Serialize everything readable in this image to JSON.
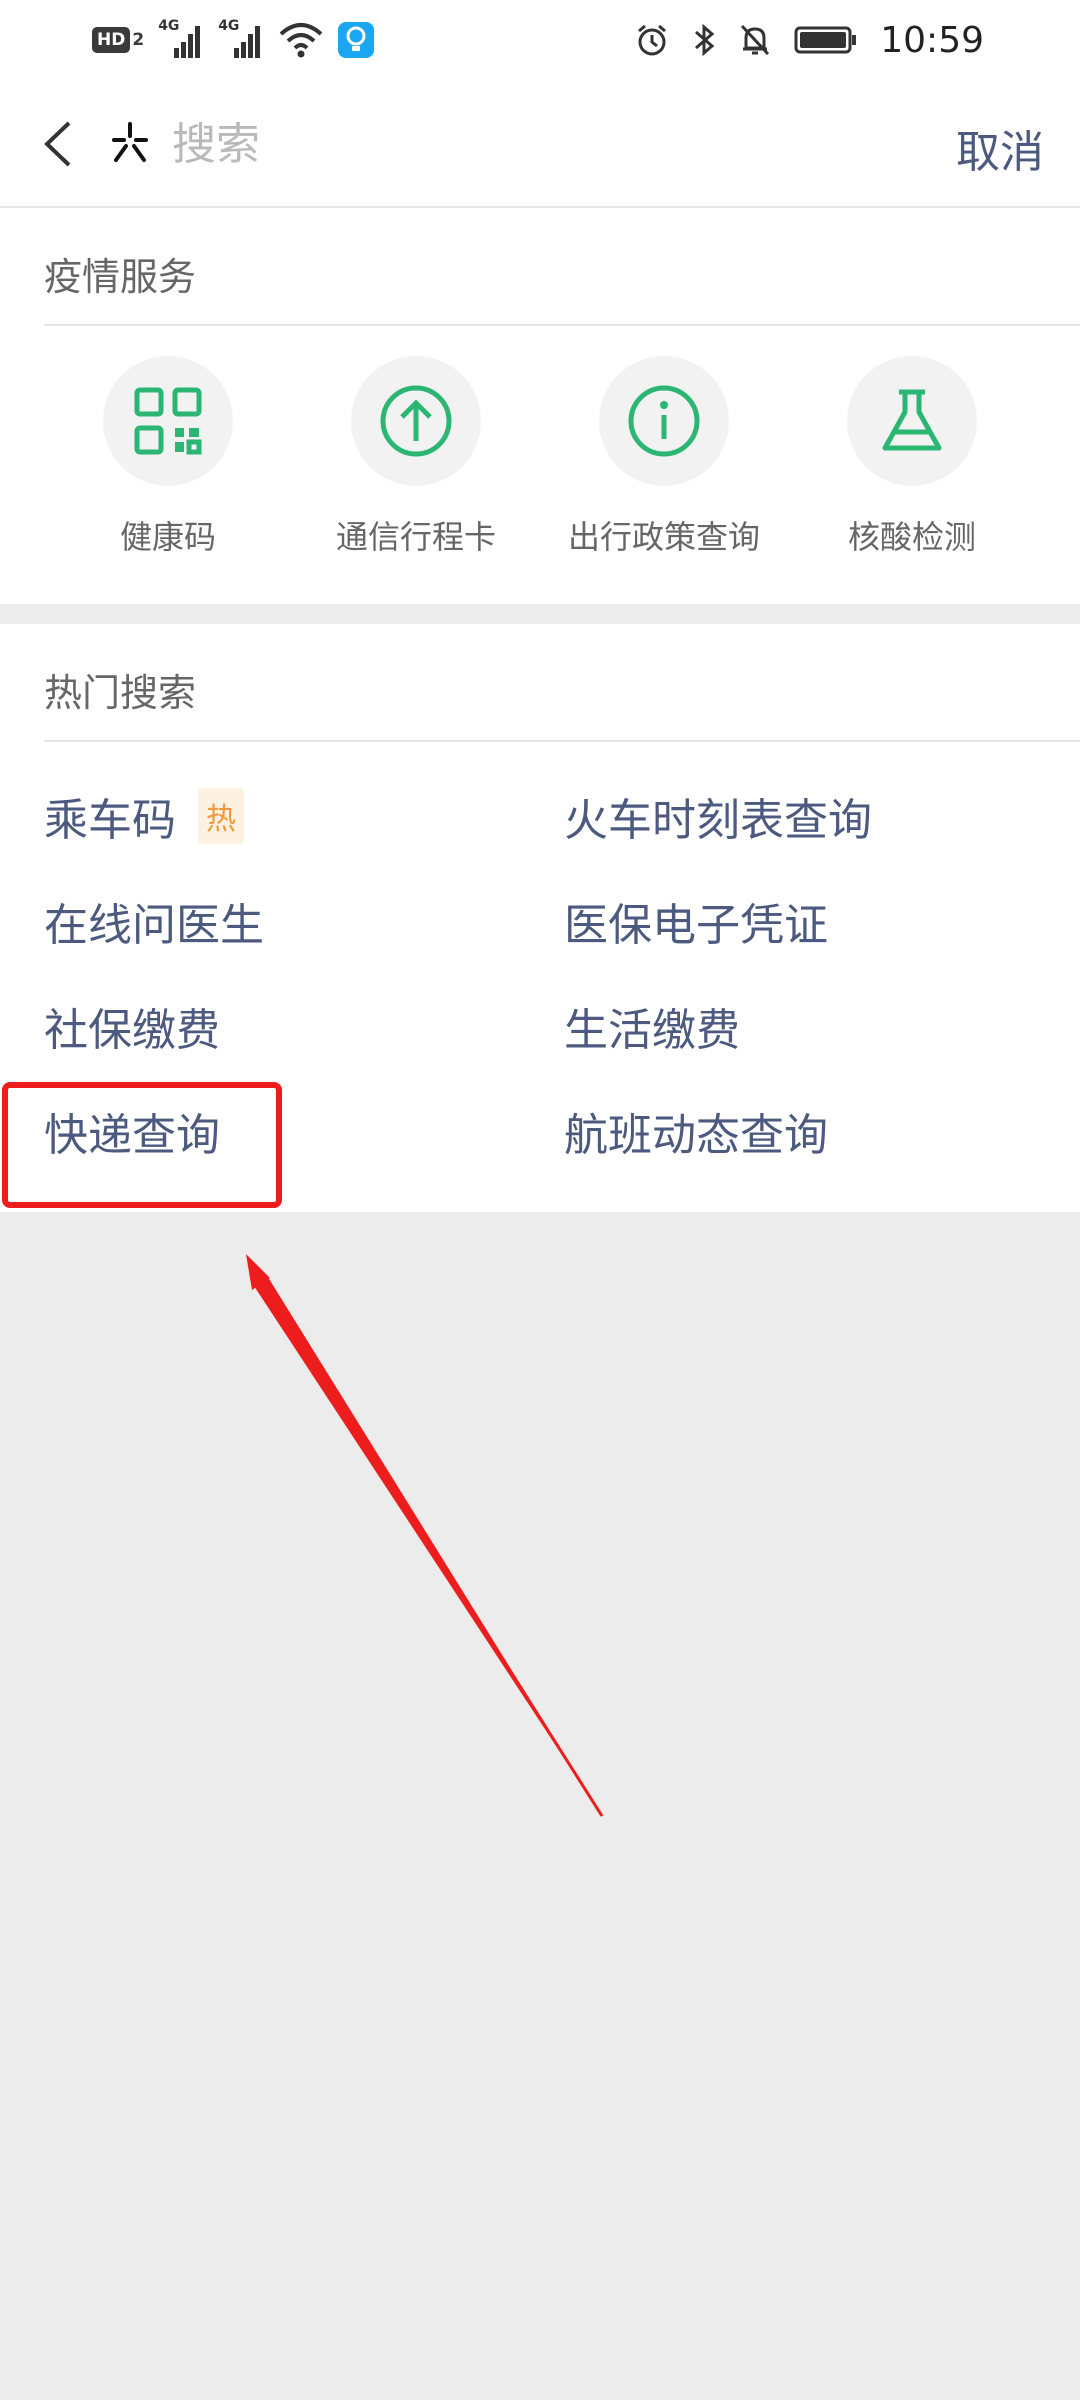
{
  "status_bar": {
    "time": "10:59",
    "hd_label": "HD",
    "hd_sub": "2",
    "signal_1_label": "4G",
    "signal_2_label": "4G",
    "icons": [
      "hd-icon",
      "signal-icon",
      "signal-icon",
      "wifi-icon",
      "app-notification-icon",
      "alarm-icon",
      "bluetooth-icon",
      "mute-icon",
      "battery-icon"
    ]
  },
  "top_bar": {
    "search_placeholder": "搜索",
    "cancel_label": "取消"
  },
  "epidemic": {
    "title": "疫情服务",
    "items": [
      {
        "label": "健康码",
        "icon": "qr-code-icon"
      },
      {
        "label": "通信行程卡",
        "icon": "arrow-up-circle-icon"
      },
      {
        "label": "出行政策查询",
        "icon": "info-circle-icon"
      },
      {
        "label": "核酸检测",
        "icon": "flask-icon"
      }
    ],
    "icon_color": "#2bb673"
  },
  "hot_search": {
    "title": "热门搜索",
    "badge_hot": "热",
    "rows": [
      {
        "left": "乘车码",
        "right": "火车时刻表查询"
      },
      {
        "left": "在线问医生",
        "right": "医保电子凭证"
      },
      {
        "left": "社保缴费",
        "right": "生活缴费"
      },
      {
        "left": "快递查询",
        "right": "航班动态查询"
      }
    ],
    "link_color": "#4d5a80"
  },
  "annotation": {
    "color": "#ee1d1d"
  }
}
